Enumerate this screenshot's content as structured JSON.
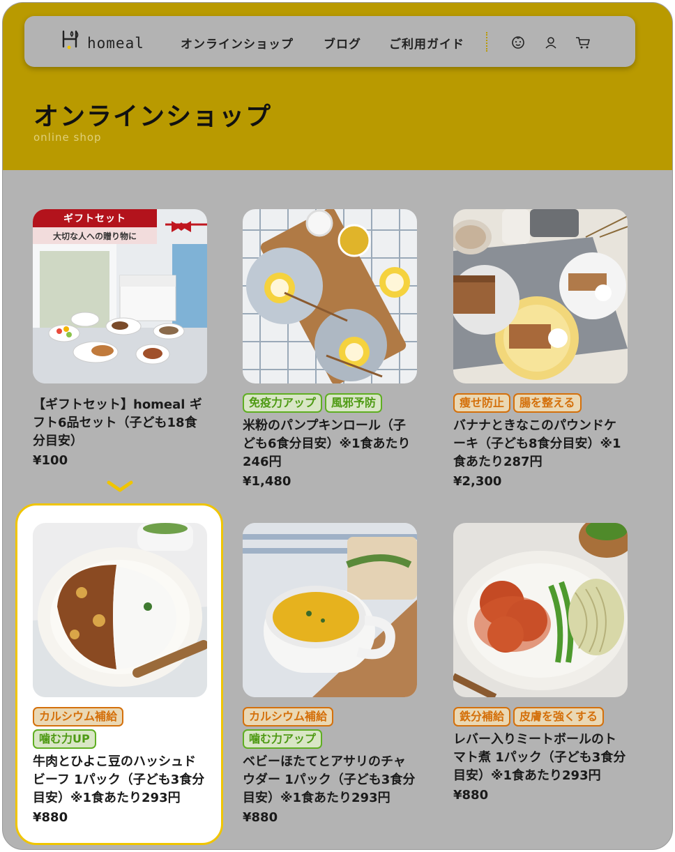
{
  "brand": {
    "name": "homeal"
  },
  "nav": {
    "links": [
      "オンラインショップ",
      "ブログ",
      "ご利用ガイド"
    ],
    "icons": [
      "baby-face-icon",
      "user-icon",
      "cart-icon"
    ]
  },
  "hero": {
    "title": "オンラインショップ",
    "subtitle": "online shop"
  },
  "products": [
    {
      "gift_banner": "ギフトセット",
      "gift_sub": "大切な人への贈り物に",
      "tags": [],
      "title": "【ギフトセット】homeal ギフト6品セット（子ども18食分目安）",
      "price": "¥100"
    },
    {
      "tags": [
        {
          "label": "免疫力アップ",
          "color": "green"
        },
        {
          "label": "風邪予防",
          "color": "green"
        }
      ],
      "title": "米粉のパンプキンロール（子ども6食分目安）※1食あたり246円",
      "price": "¥1,480"
    },
    {
      "tags": [
        {
          "label": "痩せ防止",
          "color": "orange"
        },
        {
          "label": "腸を整える",
          "color": "orange"
        }
      ],
      "title": "バナナときなこのパウンドケーキ（子ども8食分目安）※1食あたり287円",
      "price": "¥2,300"
    },
    {
      "tags": [
        {
          "label": "カルシウム補給",
          "color": "orange"
        },
        {
          "label": "噛む力UP",
          "color": "green"
        }
      ],
      "title": "牛肉とひよこ豆のハッシュドビーフ 1パック（子ども3食分目安）※1食あたり293円",
      "price": "¥880"
    },
    {
      "tags": [
        {
          "label": "カルシウム補給",
          "color": "orange"
        },
        {
          "label": "噛む力アップ",
          "color": "green"
        }
      ],
      "title": "ベビーほたてとアサリのチャウダー 1パック（子ども3食分目安）※1食あたり293円",
      "price": "¥880"
    },
    {
      "tags": [
        {
          "label": "鉄分補給",
          "color": "orange"
        },
        {
          "label": "皮膚を強くする",
          "color": "orange"
        }
      ],
      "title": "レバー入りミートボールのトマト煮 1パック（子ども3食分目安）※1食あたり293円",
      "price": "¥880"
    }
  ],
  "colors": {
    "accent": "#b99a00",
    "highlight": "#f0c500",
    "tag_orange": "#d4700b",
    "tag_green": "#5fae22"
  }
}
